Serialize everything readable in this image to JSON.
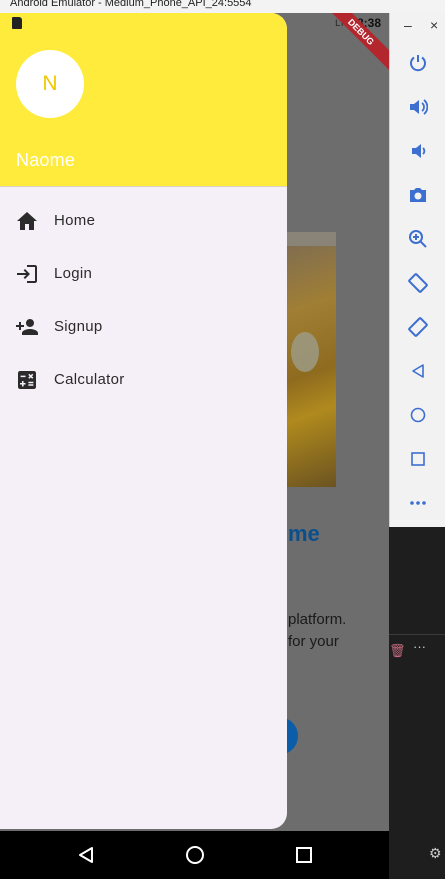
{
  "host_window": {
    "title": "Android Emulator - Medium_Phone_API_24:5554"
  },
  "status_bar": {
    "time": "8:38",
    "network": "LTE",
    "debug_banner": "DEBUG"
  },
  "drawer": {
    "avatar_initial": "N",
    "account_name": "Naome",
    "items": [
      {
        "label": "Home",
        "icon": "home-icon"
      },
      {
        "label": "Login",
        "icon": "login-icon"
      },
      {
        "label": "Signup",
        "icon": "person-add-icon"
      },
      {
        "label": "Calculator",
        "icon": "calculator-icon"
      }
    ]
  },
  "background_content": {
    "heading_fragment": "me",
    "text_line1": "platform.",
    "text_line2": "for your"
  },
  "emulator_toolbar": {
    "buttons": [
      "power-icon",
      "volume-up-icon",
      "volume-down-icon",
      "camera-icon",
      "zoom-icon",
      "rotate-left-icon",
      "rotate-right-icon",
      "back-icon",
      "home-icon",
      "overview-icon",
      "more-icon"
    ]
  },
  "colors": {
    "drawer_header": "#ffeb3b",
    "drawer_bg": "#f5f0f7",
    "accent": "#0a5da6"
  }
}
